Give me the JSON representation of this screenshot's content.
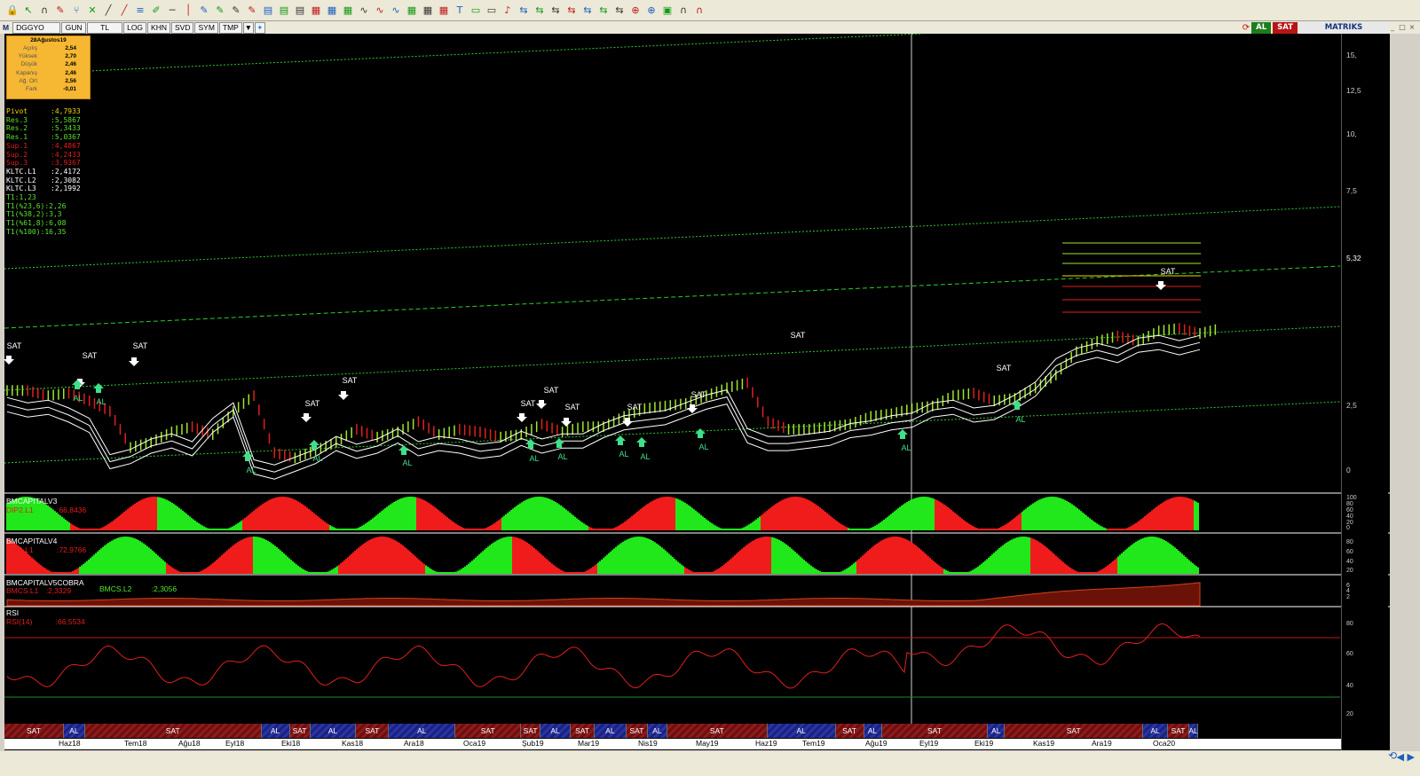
{
  "toolbar": {
    "icons": [
      "lock-icon",
      "cursor-icon",
      "magnet-icon",
      "pencil-icon",
      "fork-icon",
      "cross-icon",
      "ruler-icon",
      "ruler-icon",
      "lines-icon",
      "brush-icon",
      "hline-icon",
      "vline-icon",
      "pen-icon",
      "pen-icon",
      "pen-icon",
      "pen-icon",
      "channel-icon",
      "channel-icon",
      "channel-icon",
      "fib-icon",
      "fib-icon",
      "fib-icon",
      "wave-icon",
      "wave-icon",
      "wave-icon",
      "grid-icon",
      "grid-icon",
      "grid-icon",
      "text-icon",
      "note-icon",
      "note-icon",
      "bell-icon",
      "arrow-icon",
      "arrow-icon",
      "arrow-icon",
      "arrow-icon",
      "arrow-icon",
      "arrow-icon",
      "arrow-icon",
      "zoom-icon",
      "zoom-icon",
      "image-icon",
      "magnet-icon",
      "magnet-icon"
    ]
  },
  "symbol_bar": {
    "menu": "M",
    "symbol": "DGGYO",
    "period": "GUN",
    "type": "TL",
    "scale": "LOG",
    "khn": "KHN",
    "svd": "SVD",
    "sym": "SYM",
    "tmp": "TMP"
  },
  "right_tools": {
    "al": "AL",
    "sat": "SAT",
    "brand": "MATRIKS"
  },
  "info_box": {
    "date": "28Ağustos19",
    "rows": [
      {
        "label": "Açılış",
        "value": "2,54"
      },
      {
        "label": "Yüksek",
        "value": "2,70"
      },
      {
        "label": "Düşük",
        "value": "2,46"
      },
      {
        "label": "Kapanış",
        "value": "2,46"
      },
      {
        "label": "Ağ. Ort",
        "value": "2,56"
      },
      {
        "label": "Fark",
        "value": "-0,01"
      }
    ]
  },
  "pivot": [
    {
      "label": "Pivot",
      "value": ":4,7933",
      "color": "#f2d400"
    },
    {
      "label": "Res.3",
      "value": ":5,5867",
      "color": "#59e32c"
    },
    {
      "label": "Res.2",
      "value": ":5,3433",
      "color": "#59e32c"
    },
    {
      "label": "Res.1",
      "value": ":5,0367",
      "color": "#59e32c"
    },
    {
      "label": "Sup.1",
      "value": ":4,4867",
      "color": "#e0201c"
    },
    {
      "label": "Sup.2",
      "value": ":4,2433",
      "color": "#e0201c"
    },
    {
      "label": "Sup.3",
      "value": ":3,9367",
      "color": "#e0201c"
    },
    {
      "label": "KLTC.L1",
      "value": ":2,4172",
      "color": "#ffffff"
    },
    {
      "label": "KLTC.L2",
      "value": ":2,3082",
      "color": "#ffffff"
    },
    {
      "label": "KLTC.L3",
      "value": ":2,1992",
      "color": "#ffffff"
    },
    {
      "label": "T1:1,23",
      "value": "",
      "color": "#59e32c"
    },
    {
      "label": "T1(%23,6):2,26",
      "value": "",
      "color": "#59e32c"
    },
    {
      "label": "T1(%38,2):3,3",
      "value": "",
      "color": "#59e32c"
    },
    {
      "label": "T1(%61,8):6,08",
      "value": "",
      "color": "#59e32c"
    },
    {
      "label": "T1(%100):16,35",
      "value": "",
      "color": "#59e32c"
    }
  ],
  "main_axis": {
    "labels": [
      "15,",
      "12,5",
      "10,",
      "7,5",
      "5,32",
      "2,5",
      "0"
    ]
  },
  "signal_labels": [
    "SAT",
    "SAT",
    "SAT",
    "SAT",
    "SAT",
    "SAT",
    "SAT",
    "SAT",
    "SAT",
    "SAT",
    "SAT",
    "SAT",
    "SAT",
    "AL",
    "AL",
    "AL",
    "AL",
    "AL",
    "AL",
    "AL",
    "AL",
    "AL",
    "AL",
    "AL",
    "AL",
    "AL",
    "AL"
  ],
  "panels": {
    "p1": {
      "title": "BMCAPITALV3",
      "line": "DIP2.L1",
      "value": ":66,8436",
      "axis": [
        "100",
        "80",
        "60",
        "40",
        "20",
        "0"
      ]
    },
    "p2": {
      "title": "BMCAPITALV4",
      "line": "DIP1.L1",
      "value": ":72,9766",
      "axis": [
        "80",
        "60",
        "40",
        "20"
      ]
    },
    "p3": {
      "title": "BMCAPITALV5COBRA",
      "l1": "BMCS.L1",
      "v1": ":2,3329",
      "l2": "BMCS.L2",
      "v2": ":2,3056",
      "axis": [
        "6",
        "4",
        "2"
      ]
    },
    "p4": {
      "title": "RSI",
      "line": "RSI(14)",
      "value": ":66,5534",
      "axis": [
        "80",
        "60",
        "40",
        "20"
      ]
    }
  },
  "signal_bar": [
    {
      "type": "SAT",
      "label": "SAT"
    },
    {
      "type": "AL",
      "label": "AL"
    },
    {
      "type": "SAT",
      "label": "SAT"
    },
    {
      "type": "AL",
      "label": "AL"
    },
    {
      "type": "SAT",
      "label": "SAT"
    },
    {
      "type": "AL",
      "label": "AL"
    },
    {
      "type": "SAT",
      "label": "SAT"
    },
    {
      "type": "AL",
      "label": "AL"
    },
    {
      "type": "SAT",
      "label": "SAT"
    },
    {
      "type": "SAT",
      "label": "SAT"
    },
    {
      "type": "AL",
      "label": "AL"
    },
    {
      "type": "SAT",
      "label": "SAT"
    },
    {
      "type": "AL",
      "label": "AL"
    },
    {
      "type": "SAT",
      "label": "SAT"
    },
    {
      "type": "AL",
      "label": "AL"
    },
    {
      "type": "SAT",
      "label": "SAT"
    },
    {
      "type": "AL",
      "label": "AL"
    },
    {
      "type": "SAT",
      "label": "SAT"
    },
    {
      "type": "AL",
      "label": "AL"
    },
    {
      "type": "SAT",
      "label": "SAT"
    },
    {
      "type": "AL",
      "label": "AL"
    },
    {
      "type": "SAT",
      "label": "SAT"
    },
    {
      "type": "AL",
      "label": "AL"
    },
    {
      "type": "SAT",
      "label": "SAT"
    },
    {
      "type": "AL",
      "label": "AL"
    }
  ],
  "x_axis": [
    "Haz18",
    "Tem18",
    "Ağu18",
    "Eyl18",
    "Eki18",
    "Kas18",
    "Ara18",
    "Oca19",
    "Şub19",
    "Mar19",
    "Nis19",
    "May19",
    "Haz19",
    "Tem19",
    "Ağu19",
    "Eyl19",
    "Eki19",
    "Kas19",
    "Ara19",
    "Oca20"
  ],
  "chart_data": {
    "type": "candlestick",
    "title": "DGGYO",
    "date_range": [
      "Haz18",
      "Oca20"
    ],
    "ylim": [
      0,
      15
    ],
    "last_price": 5.32,
    "series": [
      {
        "name": "close",
        "values": [
          2.9,
          2.7,
          2.8,
          2.5,
          2.1,
          0.7,
          0.9,
          1.3,
          1.5,
          1.2,
          2.1,
          2.7,
          0.5,
          0.3,
          0.6,
          0.9,
          1.4,
          1.1,
          1.3,
          1.7,
          1.2,
          1.4,
          1.3,
          1.1,
          1.2,
          1.6,
          1.3,
          1.5,
          1.5,
          1.9,
          2.2,
          2.3,
          2.4,
          2.7,
          3.0,
          3.2,
          1.7,
          1.4,
          1.4,
          1.5,
          1.6,
          1.9,
          2.0,
          2.2,
          2.3,
          2.7,
          2.8,
          2.5,
          2.6,
          3.0,
          3.5,
          4.4,
          4.8,
          5.0,
          4.8,
          5.2,
          5.3,
          5.1,
          5.3
        ]
      }
    ]
  }
}
